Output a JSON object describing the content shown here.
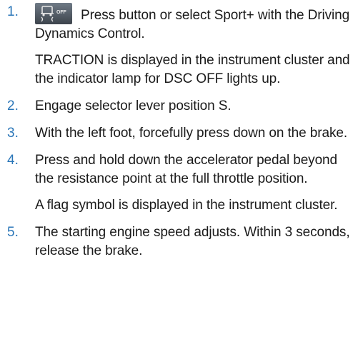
{
  "colors": {
    "step_number": "#2a76b8",
    "text": "#1a1a1a",
    "button_bg_top": "#6f7a86",
    "button_bg_bottom": "#3d444c",
    "button_symbol": "#e8e8e8"
  },
  "icons": {
    "dsc_off_button": "dsc-off-button-icon"
  },
  "steps": [
    {
      "number": "1.",
      "icon": "dsc-off-button-icon",
      "icon_text": "OFF",
      "text": "Press button or select Sport+ with the Driving Dynamics Control.",
      "note": "TRACTION is displayed in the instrument cluster and the indicator lamp for DSC OFF lights up."
    },
    {
      "number": "2.",
      "text": "Engage selector lever position S."
    },
    {
      "number": "3.",
      "text": "With the left foot, forcefully press down on the brake."
    },
    {
      "number": "4.",
      "text": "Press and hold down the accelerator pedal beyond the resistance point at the full throttle position.",
      "note": "A flag symbol is displayed in the instru­ment cluster."
    },
    {
      "number": "5.",
      "text": "The starting engine speed adjusts. Within 3 seconds, release the brake."
    }
  ]
}
